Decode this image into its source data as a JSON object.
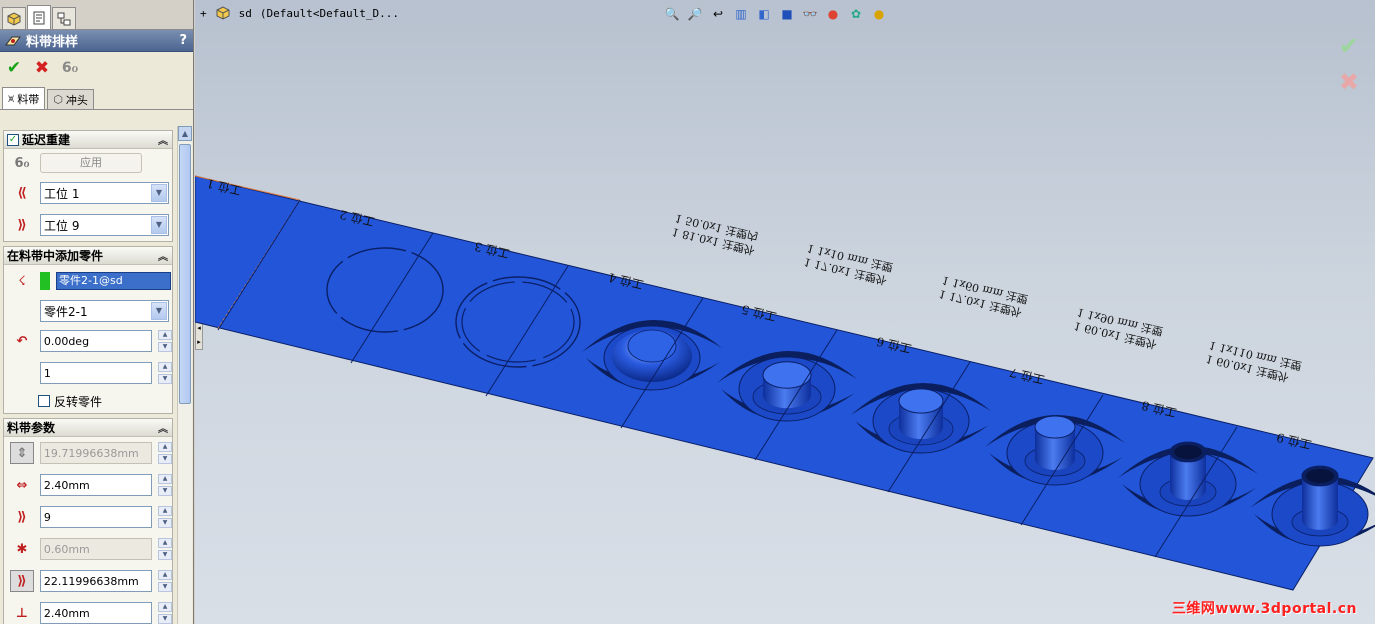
{
  "panel": {
    "title": "料带排样",
    "help": "?",
    "tabs": [
      "料带",
      "冲头"
    ],
    "delay_rebuild": {
      "header": "延迟重建",
      "apply": "应用",
      "from_station": "工位 1",
      "to_station": "工位 9"
    },
    "add_part": {
      "header": "在料带中添加零件",
      "selected": "零件2-1@sd",
      "part": "零件2-1",
      "angle": "0.00deg",
      "count": "1",
      "flip_label": "反转零件"
    },
    "strip_params": {
      "header": "料带参数",
      "width": "19.71996638mm",
      "gap": "2.40mm",
      "stations": "9",
      "thickness": "0.60mm",
      "pitch": "22.11996638mm",
      "bottom": "2.40mm"
    }
  },
  "viewport": {
    "tree_node": "sd",
    "config": "(Default<Default_D...",
    "stations": [
      "工位 1",
      "工位 2",
      "工位 3",
      "工位 4",
      "工位 5",
      "工位 6",
      "工位 7",
      "工位 8",
      "工位 9"
    ],
    "annotations": [
      [
        "1 81.0x1 注塑外",
        "1 50.0x1 注塑内"
      ],
      [
        "1 17.0x1 注塑外",
        "1 1x10 mm 注塑"
      ],
      [
        "1 17.0x1 注塑外",
        "1 1x60 mm 注塑"
      ],
      [
        "1 60.0x1 注塑外",
        "1 1x90 mm 注塑"
      ],
      [
        "1 60.0x1 注塑外",
        "1 1x110 mm 注塑"
      ]
    ],
    "watermark": "三维网www.3dportal.cn"
  },
  "colors": {
    "strip": "#2255d8",
    "strip_edge": "#0a1f66",
    "accent": "#ff2020"
  },
  "icons": [
    "part-icon",
    "properties-icon",
    "config-icon",
    "ok-icon",
    "cancel-icon",
    "preview-icon",
    "strip-icon",
    "punch-icon"
  ]
}
